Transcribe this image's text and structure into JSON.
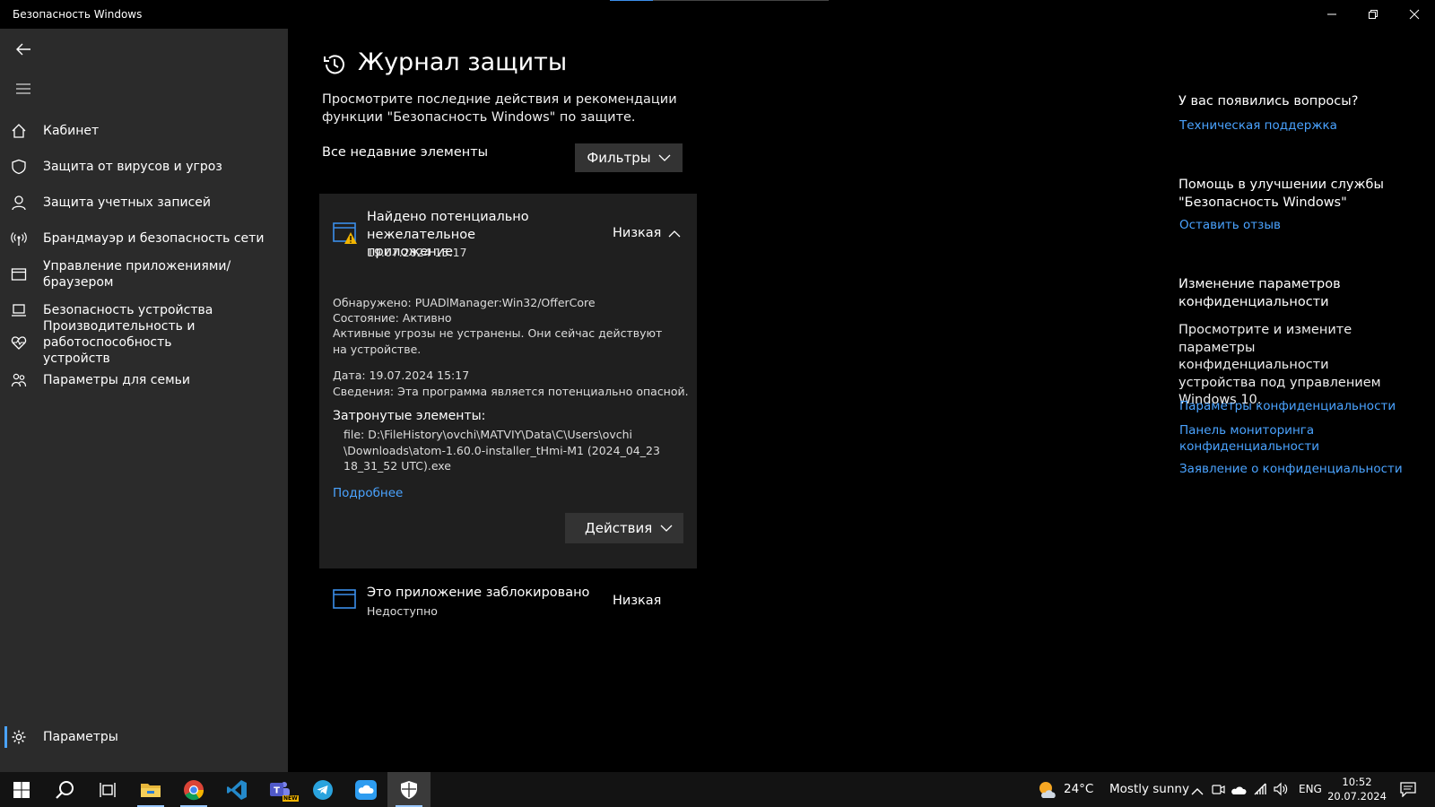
{
  "window": {
    "title": "Безопасность Windows"
  },
  "sidebar": {
    "items": [
      {
        "label": "Кабинет",
        "icon": "home-icon"
      },
      {
        "label": "Защита от вирусов и угроз",
        "icon": "shield-icon"
      },
      {
        "label": "Защита учетных записей",
        "icon": "person-icon"
      },
      {
        "label": "Брандмауэр и безопасность сети",
        "icon": "antenna-icon"
      },
      {
        "label": "Управление приложениями/браузером",
        "icon": "app-window-icon"
      },
      {
        "label": "Безопасность устройства",
        "icon": "laptop-icon"
      },
      {
        "label": "Производительность и работоспособность устройств",
        "icon": "heart-pulse-icon"
      },
      {
        "label": "Параметры для семьи",
        "icon": "family-icon"
      }
    ],
    "settings_label": "Параметры"
  },
  "page": {
    "title": "Журнал защиты",
    "description": "Просмотрите последние действия и рекомендации функции \"Безопасность Windows\" по защите.",
    "recent_label": "Все недавние элементы",
    "filters_label": "Фильтры"
  },
  "threat": {
    "title": "Найдено потенциально нежелательное приложение",
    "date": "19.07.2024 15:17",
    "severity": "Низкая",
    "detected_label": "Обнаружено:",
    "detected_value": "PUADlManager:Win32/OfferCore",
    "status_label": "Состояние:",
    "status_value": "Активно",
    "status_note": "Активные угрозы не устранены. Они сейчас действуют на устройстве.",
    "date_label": "Дата:",
    "date_value": "19.07.2024 15:17",
    "details_label": "Сведения:",
    "details_value": "Эта программа является потенциально опасной.",
    "affected_title": "Затронутые элементы:",
    "affected_lines": [
      "file: D:\\FileHistory\\ovchi\\MATVIY\\Data\\C\\Users\\ovchi",
      "\\Downloads\\atom-1.60.0-installer_tHmi-M1 (2024_04_23",
      "18_31_52 UTC).exe"
    ],
    "more_link": "Подробнее",
    "actions_label": "Действия"
  },
  "blocked": {
    "title": "Это приложение заблокировано",
    "subtitle": "Недоступно",
    "severity": "Низкая"
  },
  "right": {
    "questions_title": "У вас появились вопросы?",
    "support_link": "Техническая поддержка",
    "feedback_title": "Помощь в улучшении службы \"Безопасность Windows\"",
    "feedback_link": "Оставить отзыв",
    "privacy_title": "Изменение параметров конфиденциальности",
    "privacy_text": "Просмотрите и измените параметры конфиденциальности устройства под управлением Windows 10.",
    "privacy_links": [
      "Параметры конфиденциальности",
      "Панель мониторинга конфиденциальности",
      "Заявление о конфиденциальности"
    ]
  },
  "taskbar": {
    "weather_temp": "24°C",
    "weather_text": "Mostly sunny",
    "language": "ENG",
    "time": "10:52",
    "date": "20.07.2024",
    "apps": [
      "start-icon",
      "search-icon",
      "task-view-icon",
      "file-explorer-icon",
      "chrome-icon",
      "vscode-icon",
      "teams-icon",
      "telegram-icon",
      "cloud-app-icon",
      "windows-security-icon"
    ],
    "teams_badge": "NEW"
  },
  "colors": {
    "accent": "#4aa3ff",
    "sidebar_bg": "#2b2b2b",
    "panel_bg": "#1f1f1f",
    "warning": "#f2b400"
  }
}
